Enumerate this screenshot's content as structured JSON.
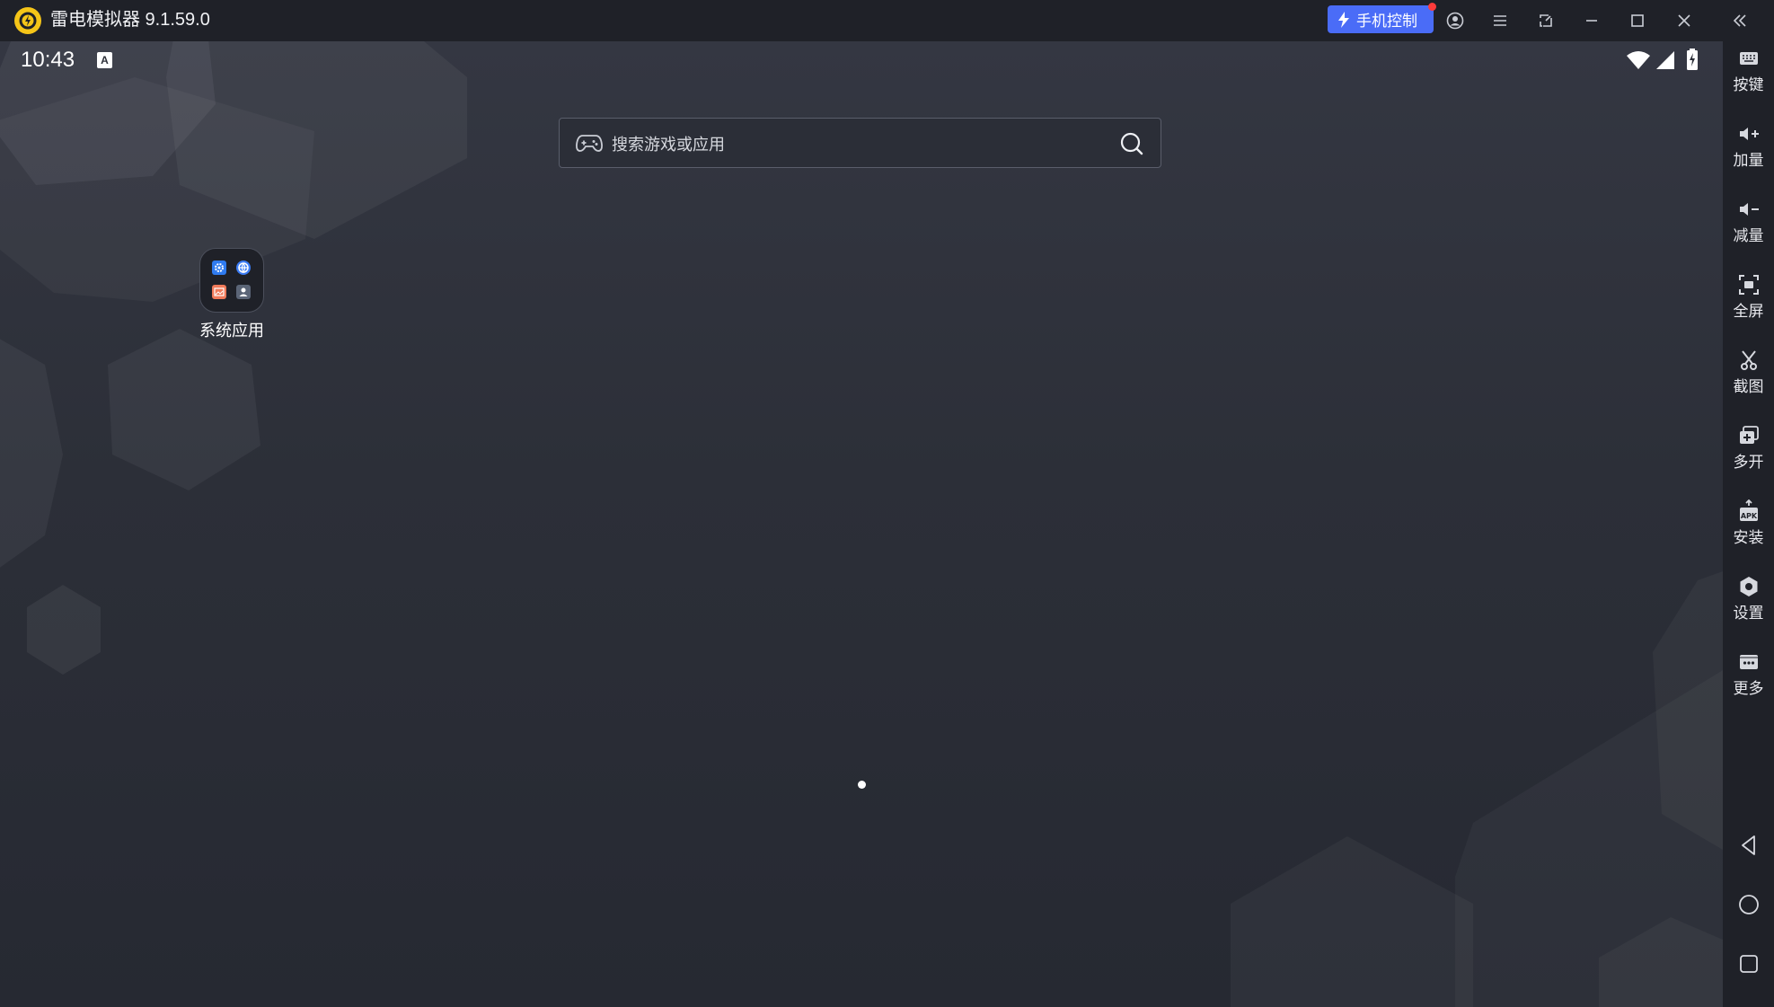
{
  "titlebar": {
    "app_title": "雷电模拟器 9.1.59.0",
    "phone_control_label": "手机控制",
    "icons": [
      "logo-icon",
      "lightning-icon",
      "account-icon",
      "menu-icon",
      "screen-icon",
      "minimize-icon",
      "maximize-icon",
      "close-icon",
      "collapse-sidebar-icon"
    ]
  },
  "status_bar": {
    "time": "10:43",
    "notification_icon_letter": "A",
    "icons": [
      "wifi-icon",
      "signal-icon",
      "battery-charging-icon"
    ]
  },
  "search": {
    "placeholder": "搜索游戏或应用",
    "icons": [
      "gamepad-icon",
      "search-icon"
    ]
  },
  "home": {
    "folder_label": "系统应用",
    "folder_apps": [
      "settings-app-icon",
      "browser-app-icon",
      "gallery-app-icon",
      "contacts-app-icon"
    ]
  },
  "sidebar": {
    "items": [
      {
        "label": "按键",
        "icon": "keyboard-icon"
      },
      {
        "label": "加量",
        "icon": "volume-up-icon"
      },
      {
        "label": "减量",
        "icon": "volume-down-icon"
      },
      {
        "label": "全屏",
        "icon": "fullscreen-icon"
      },
      {
        "label": "截图",
        "icon": "scissors-icon"
      },
      {
        "label": "多开",
        "icon": "multi-instance-icon"
      },
      {
        "label": "安装",
        "icon": "apk-install-icon"
      },
      {
        "label": "设置",
        "icon": "settings-icon"
      },
      {
        "label": "更多",
        "icon": "more-icon"
      }
    ],
    "nav": [
      "back-icon",
      "home-icon",
      "recents-icon"
    ]
  },
  "colors": {
    "titlebar_bg": "#1f2128",
    "accent_blue": "#4a6cf7",
    "logo_yellow": "#f5c518",
    "android_bg": "#2c2f38",
    "notification_red": "#ff3b3b"
  }
}
